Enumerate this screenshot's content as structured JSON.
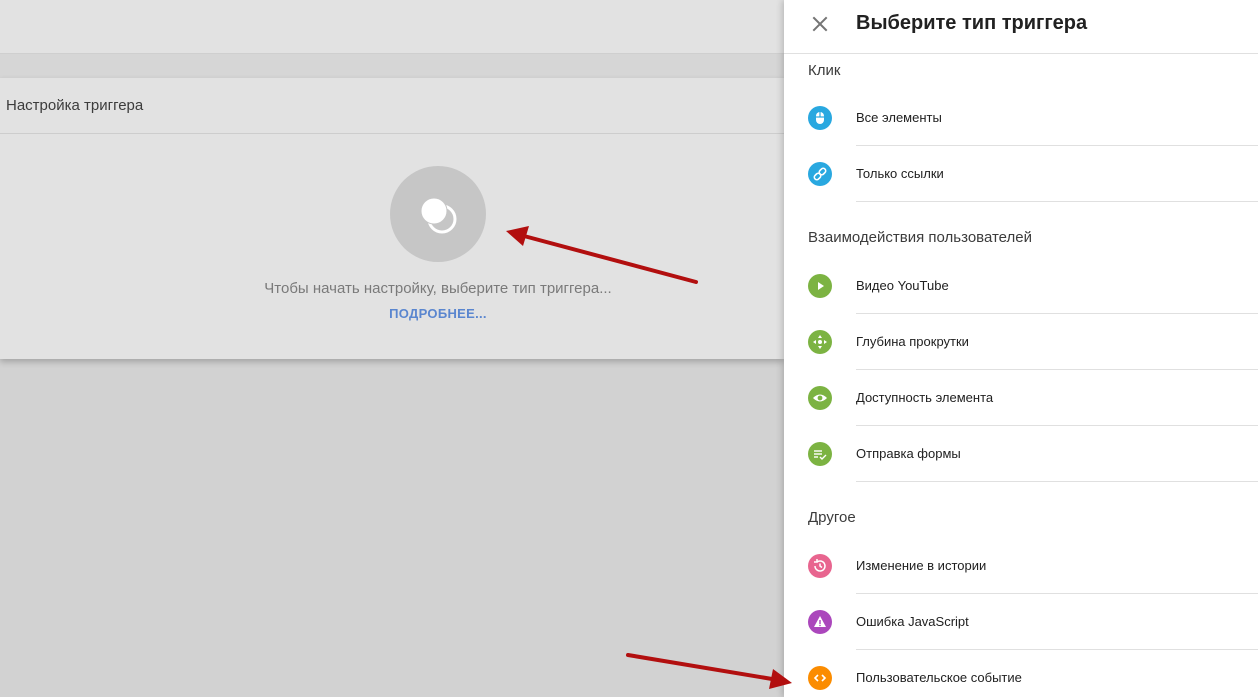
{
  "background": {
    "card_title": "Настройка триггера",
    "hint": "Чтобы начать настройку, выберите тип триггера...",
    "learn_more": "ПОДРОБНЕЕ..."
  },
  "panel": {
    "title": "Выберите тип триггера",
    "close_icon": "close-icon",
    "sections": [
      {
        "title": "Клик",
        "items": [
          {
            "label": "Все элементы",
            "icon": "mouse-icon",
            "color": "#29a8e0"
          },
          {
            "label": "Только ссылки",
            "icon": "link-icon",
            "color": "#29a8e0"
          }
        ]
      },
      {
        "title": "Взаимодействия пользователей",
        "items": [
          {
            "label": "Видео YouTube",
            "icon": "play-icon",
            "color": "#7cb342"
          },
          {
            "label": "Глубина прокрутки",
            "icon": "move-icon",
            "color": "#7cb342"
          },
          {
            "label": "Доступность элемента",
            "icon": "eye-icon",
            "color": "#7cb342"
          },
          {
            "label": "Отправка формы",
            "icon": "form-submit-icon",
            "color": "#7cb342"
          }
        ]
      },
      {
        "title": "Другое",
        "items": [
          {
            "label": "Изменение в истории",
            "icon": "history-icon",
            "color": "#e8658f"
          },
          {
            "label": "Ошибка JavaScript",
            "icon": "warning-icon",
            "color": "#ab47bc"
          },
          {
            "label": "Пользовательское событие",
            "icon": "code-icon",
            "color": "#fb8c00"
          }
        ]
      }
    ]
  },
  "annotation_color": "#b20f0f"
}
